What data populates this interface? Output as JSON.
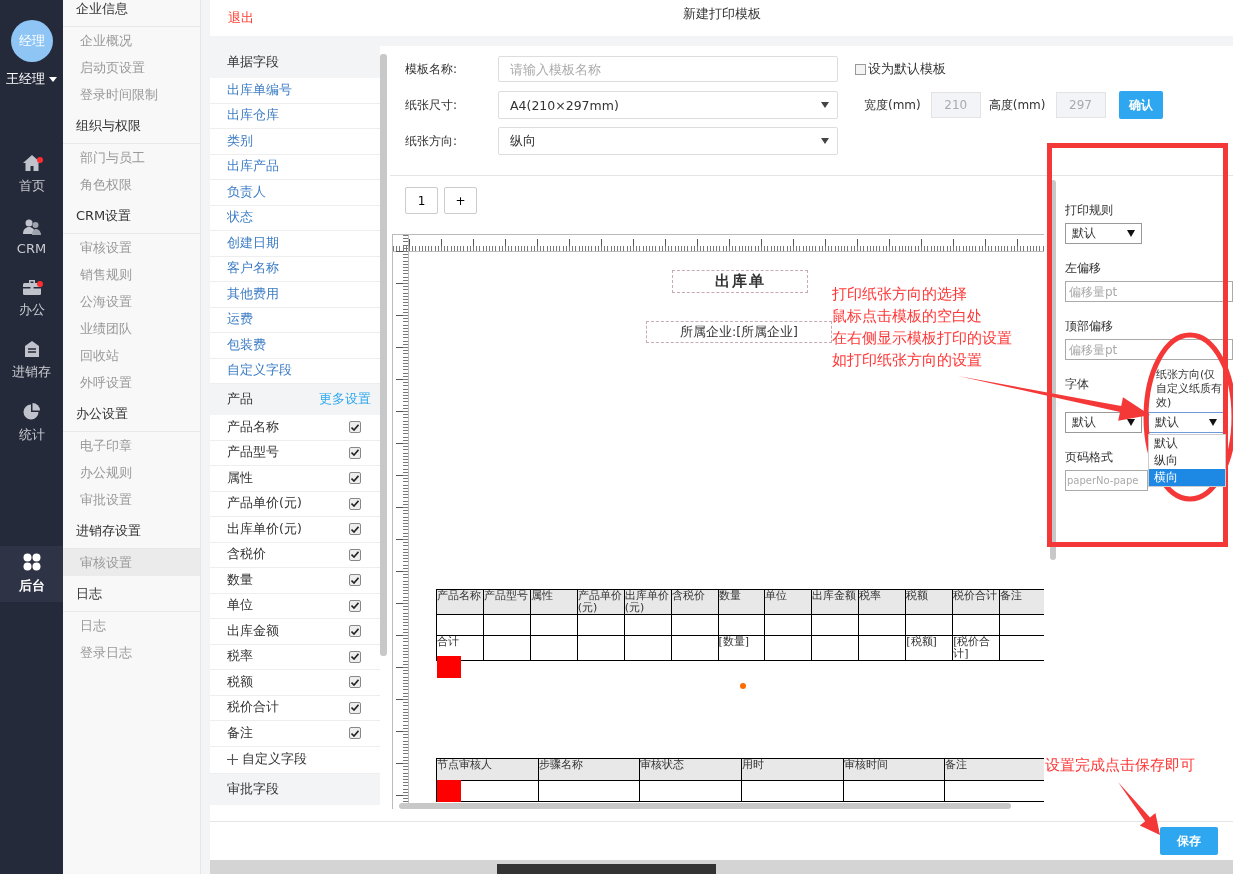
{
  "user": {
    "avatar_text": "经理",
    "name": "王经理"
  },
  "nav": [
    {
      "label": "首页",
      "badge": true,
      "selected": false
    },
    {
      "label": "CRM",
      "badge": false,
      "selected": false
    },
    {
      "label": "办公",
      "badge": true,
      "selected": false
    },
    {
      "label": "进销存",
      "badge": false,
      "selected": false
    },
    {
      "label": "统计",
      "badge": false,
      "selected": false
    },
    {
      "label": "后台",
      "badge": false,
      "selected": true
    }
  ],
  "menu": [
    {
      "title": "企业信息",
      "items": [
        {
          "label": "企业概况",
          "selected": false
        },
        {
          "label": "启动页设置",
          "selected": false
        },
        {
          "label": "登录时间限制",
          "selected": false
        }
      ]
    },
    {
      "title": "组织与权限",
      "items": [
        {
          "label": "部门与员工",
          "selected": false
        },
        {
          "label": "角色权限",
          "selected": false
        }
      ]
    },
    {
      "title": "CRM设置",
      "items": [
        {
          "label": "审核设置",
          "selected": false
        },
        {
          "label": "销售规则",
          "selected": false
        },
        {
          "label": "公海设置",
          "selected": false
        },
        {
          "label": "业绩团队",
          "selected": false
        },
        {
          "label": "回收站",
          "selected": false
        },
        {
          "label": "外呼设置",
          "selected": false
        }
      ]
    },
    {
      "title": "办公设置",
      "items": [
        {
          "label": "电子印章",
          "selected": false
        },
        {
          "label": "办公规则",
          "selected": false
        },
        {
          "label": "审批设置",
          "selected": false
        }
      ]
    },
    {
      "title": "进销存设置",
      "items": [
        {
          "label": "审核设置",
          "selected": true
        }
      ]
    },
    {
      "title": "日志",
      "items": [
        {
          "label": "日志",
          "selected": false
        },
        {
          "label": "登录日志",
          "selected": false
        }
      ]
    }
  ],
  "header": {
    "exit": "退出",
    "title": "新建打印模板"
  },
  "fields": [
    {
      "title": "单据字段",
      "kind": "links",
      "items": [
        {
          "label": "出库单编号"
        },
        {
          "label": "出库仓库"
        },
        {
          "label": "类别"
        },
        {
          "label": "出库产品"
        },
        {
          "label": "负责人"
        },
        {
          "label": "状态"
        },
        {
          "label": "创建日期"
        },
        {
          "label": "客户名称"
        },
        {
          "label": "其他费用"
        },
        {
          "label": "运费"
        },
        {
          "label": "包装费"
        },
        {
          "label": "自定义字段"
        }
      ]
    },
    {
      "title": "产品",
      "action": "更多设置",
      "kind": "checks",
      "add": "自定义字段",
      "items": [
        {
          "label": "产品名称",
          "checked": true
        },
        {
          "label": "产品型号",
          "checked": true
        },
        {
          "label": "属性",
          "checked": true
        },
        {
          "label": "产品单价(元)",
          "checked": true
        },
        {
          "label": "出库单价(元)",
          "checked": true
        },
        {
          "label": "含税价",
          "checked": true
        },
        {
          "label": "数量",
          "checked": true
        },
        {
          "label": "单位",
          "checked": true
        },
        {
          "label": "出库金额",
          "checked": true
        },
        {
          "label": "税率",
          "checked": true
        },
        {
          "label": "税额",
          "checked": true
        },
        {
          "label": "税价合计",
          "checked": true
        },
        {
          "label": "备注",
          "checked": true
        }
      ]
    },
    {
      "title": "审批字段",
      "kind": "header"
    }
  ],
  "form": {
    "name_label": "模板名称:",
    "name_placeholder": "请输入模板名称",
    "default_label": "设为默认模板",
    "default_checked": false,
    "size_label": "纸张尺寸:",
    "size_value": "A4(210×297mm)",
    "width_label": "宽度(mm)",
    "width_value": "210",
    "height_label": "高度(mm)",
    "height_value": "297",
    "confirm": "确认",
    "orientation_label": "纸张方向:",
    "orientation_value": "纵向"
  },
  "page_tabs": [
    "1",
    "+"
  ],
  "canvas": {
    "title": "出库单",
    "company": "所属企业:[所属企业]",
    "product_table": {
      "columns": [
        {
          "label": "产品名称",
          "total": "合计"
        },
        {
          "label": "产品型号"
        },
        {
          "label": "属性"
        },
        {
          "label": "产品单价(元)"
        },
        {
          "label": "出库单价(元)"
        },
        {
          "label": "含税价"
        },
        {
          "label": "数量",
          "total": "[数量]"
        },
        {
          "label": "单位"
        },
        {
          "label": "出库金额"
        },
        {
          "label": "税率"
        },
        {
          "label": "税额",
          "total": "[税额]"
        },
        {
          "label": "税价合计",
          "total": "[税价合计]"
        },
        {
          "label": "备注"
        }
      ]
    },
    "approval_table": {
      "columns": [
        "节点审核人",
        "步骤名称",
        "审核状态",
        "用时",
        "审核时间",
        "备注"
      ]
    }
  },
  "print_settings": {
    "rule_label": "打印规则",
    "rule_value": "默认",
    "left_offset_label": "左偏移",
    "left_offset_placeholder": "偏移量pt",
    "top_offset_label": "顶部偏移",
    "top_offset_placeholder": "偏移量pt",
    "font_label": "字体",
    "font_value": "默认",
    "orientation_label": "纸张方向(仅自定义纸质有效)",
    "orientation_value": "默认",
    "orientation_options": [
      {
        "label": "默认",
        "selected": false
      },
      {
        "label": "纵向",
        "selected": false
      },
      {
        "label": "横向",
        "selected": true
      }
    ],
    "page_format_label": "页码格式",
    "page_format_placeholder": "paperNo-pape"
  },
  "save": "保存",
  "annotations": {
    "note_lines": [
      "打印纸张方向的选择",
      "鼠标点击模板的空白处",
      "在右侧显示模板打印的设置",
      "如打印纸张方向的设置"
    ],
    "save_note": "设置完成点击保存即可"
  }
}
